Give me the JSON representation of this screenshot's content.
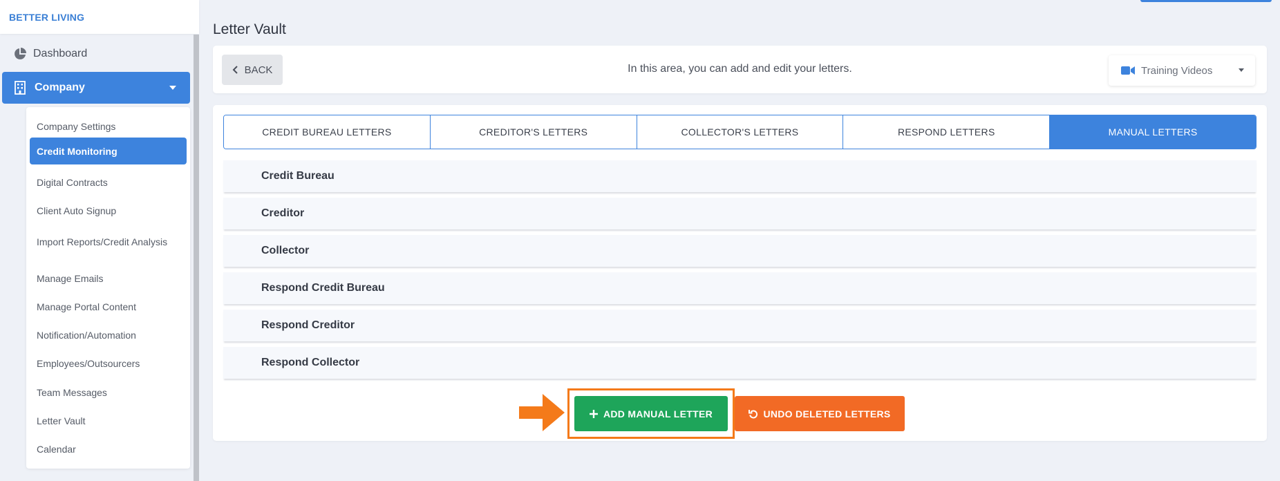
{
  "brand": "BETTER LIVING",
  "sidebar": {
    "dashboard_label": "Dashboard",
    "company_label": "Company",
    "submenu": [
      {
        "label": "Company Settings"
      },
      {
        "label": "Credit Monitoring"
      },
      {
        "label": "Digital Contracts"
      },
      {
        "label": "Client Auto Signup"
      },
      {
        "label": "Import Reports/Credit Analysis"
      },
      {
        "label": "Manage Emails"
      },
      {
        "label": "Manage Portal Content"
      },
      {
        "label": "Notification/Automation"
      },
      {
        "label": "Employees/Outsourcers"
      },
      {
        "label": "Team Messages"
      },
      {
        "label": "Letter Vault"
      },
      {
        "label": "Calendar"
      }
    ],
    "active_submenu": "Credit Monitoring"
  },
  "page": {
    "title": "Letter Vault",
    "back_label": "BACK",
    "info_message": "In this area, you can add and edit your letters.",
    "training_label": "Training Videos"
  },
  "tabs": [
    {
      "label": "CREDIT BUREAU LETTERS"
    },
    {
      "label": "CREDITOR'S LETTERS"
    },
    {
      "label": "COLLECTOR'S LETTERS"
    },
    {
      "label": "RESPOND LETTERS"
    },
    {
      "label": "MANUAL LETTERS"
    }
  ],
  "active_tab": "MANUAL LETTERS",
  "sections": [
    {
      "label": "Credit Bureau"
    },
    {
      "label": "Creditor"
    },
    {
      "label": "Collector"
    },
    {
      "label": "Respond Credit Bureau"
    },
    {
      "label": "Respond Creditor"
    },
    {
      "label": "Respond Collector"
    }
  ],
  "actions": {
    "add_label": "ADD MANUAL LETTER",
    "undo_label": "UNDO DELETED LETTERS"
  },
  "colors": {
    "primary": "#3d83dd",
    "add_green": "#1ea55a",
    "undo_orange": "#f26a25",
    "highlight_orange": "#f47a1a"
  },
  "icons": {
    "dashboard": "pie-chart-icon",
    "company": "building-icon",
    "back": "chevron-left-icon",
    "training": "video-camera-icon",
    "add": "plus-icon",
    "undo": "undo-icon",
    "pointer": "arrow-right-icon"
  }
}
